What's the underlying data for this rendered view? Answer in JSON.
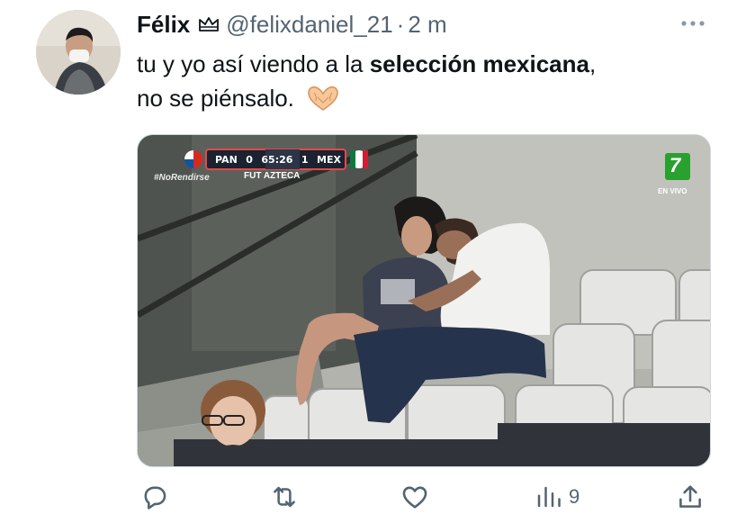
{
  "tweet": {
    "author": {
      "name": "Félix",
      "handle": "@felixdaniel_21",
      "separator": "·",
      "time": "2 m",
      "badge_icon": "crown-icon"
    },
    "text_part1": "tu y yo así viendo a la ",
    "text_bold": "selección mexicana",
    "text_part2": ",",
    "text_line2": "no se piénsalo.",
    "emoji": "heart-hands-emoji",
    "media": {
      "description": "Couple in stadium stands",
      "scoreboard": {
        "home": "PAN",
        "home_score": "0",
        "clock": "65:26",
        "away_score": "1",
        "away": "MEX",
        "broadcaster": "FUT AZTECA",
        "hashtag": "#NoRendirse",
        "channel": "7",
        "live_label": "EN VIVO"
      }
    },
    "actions": {
      "reply_icon": "reply-icon",
      "retweet_icon": "retweet-icon",
      "like_icon": "heart-icon",
      "views_icon": "views-icon",
      "views_count": "9",
      "share_icon": "share-icon"
    },
    "colors": {
      "text": "#0f1419",
      "secondary": "#536471",
      "border": "#cfd9de"
    }
  }
}
